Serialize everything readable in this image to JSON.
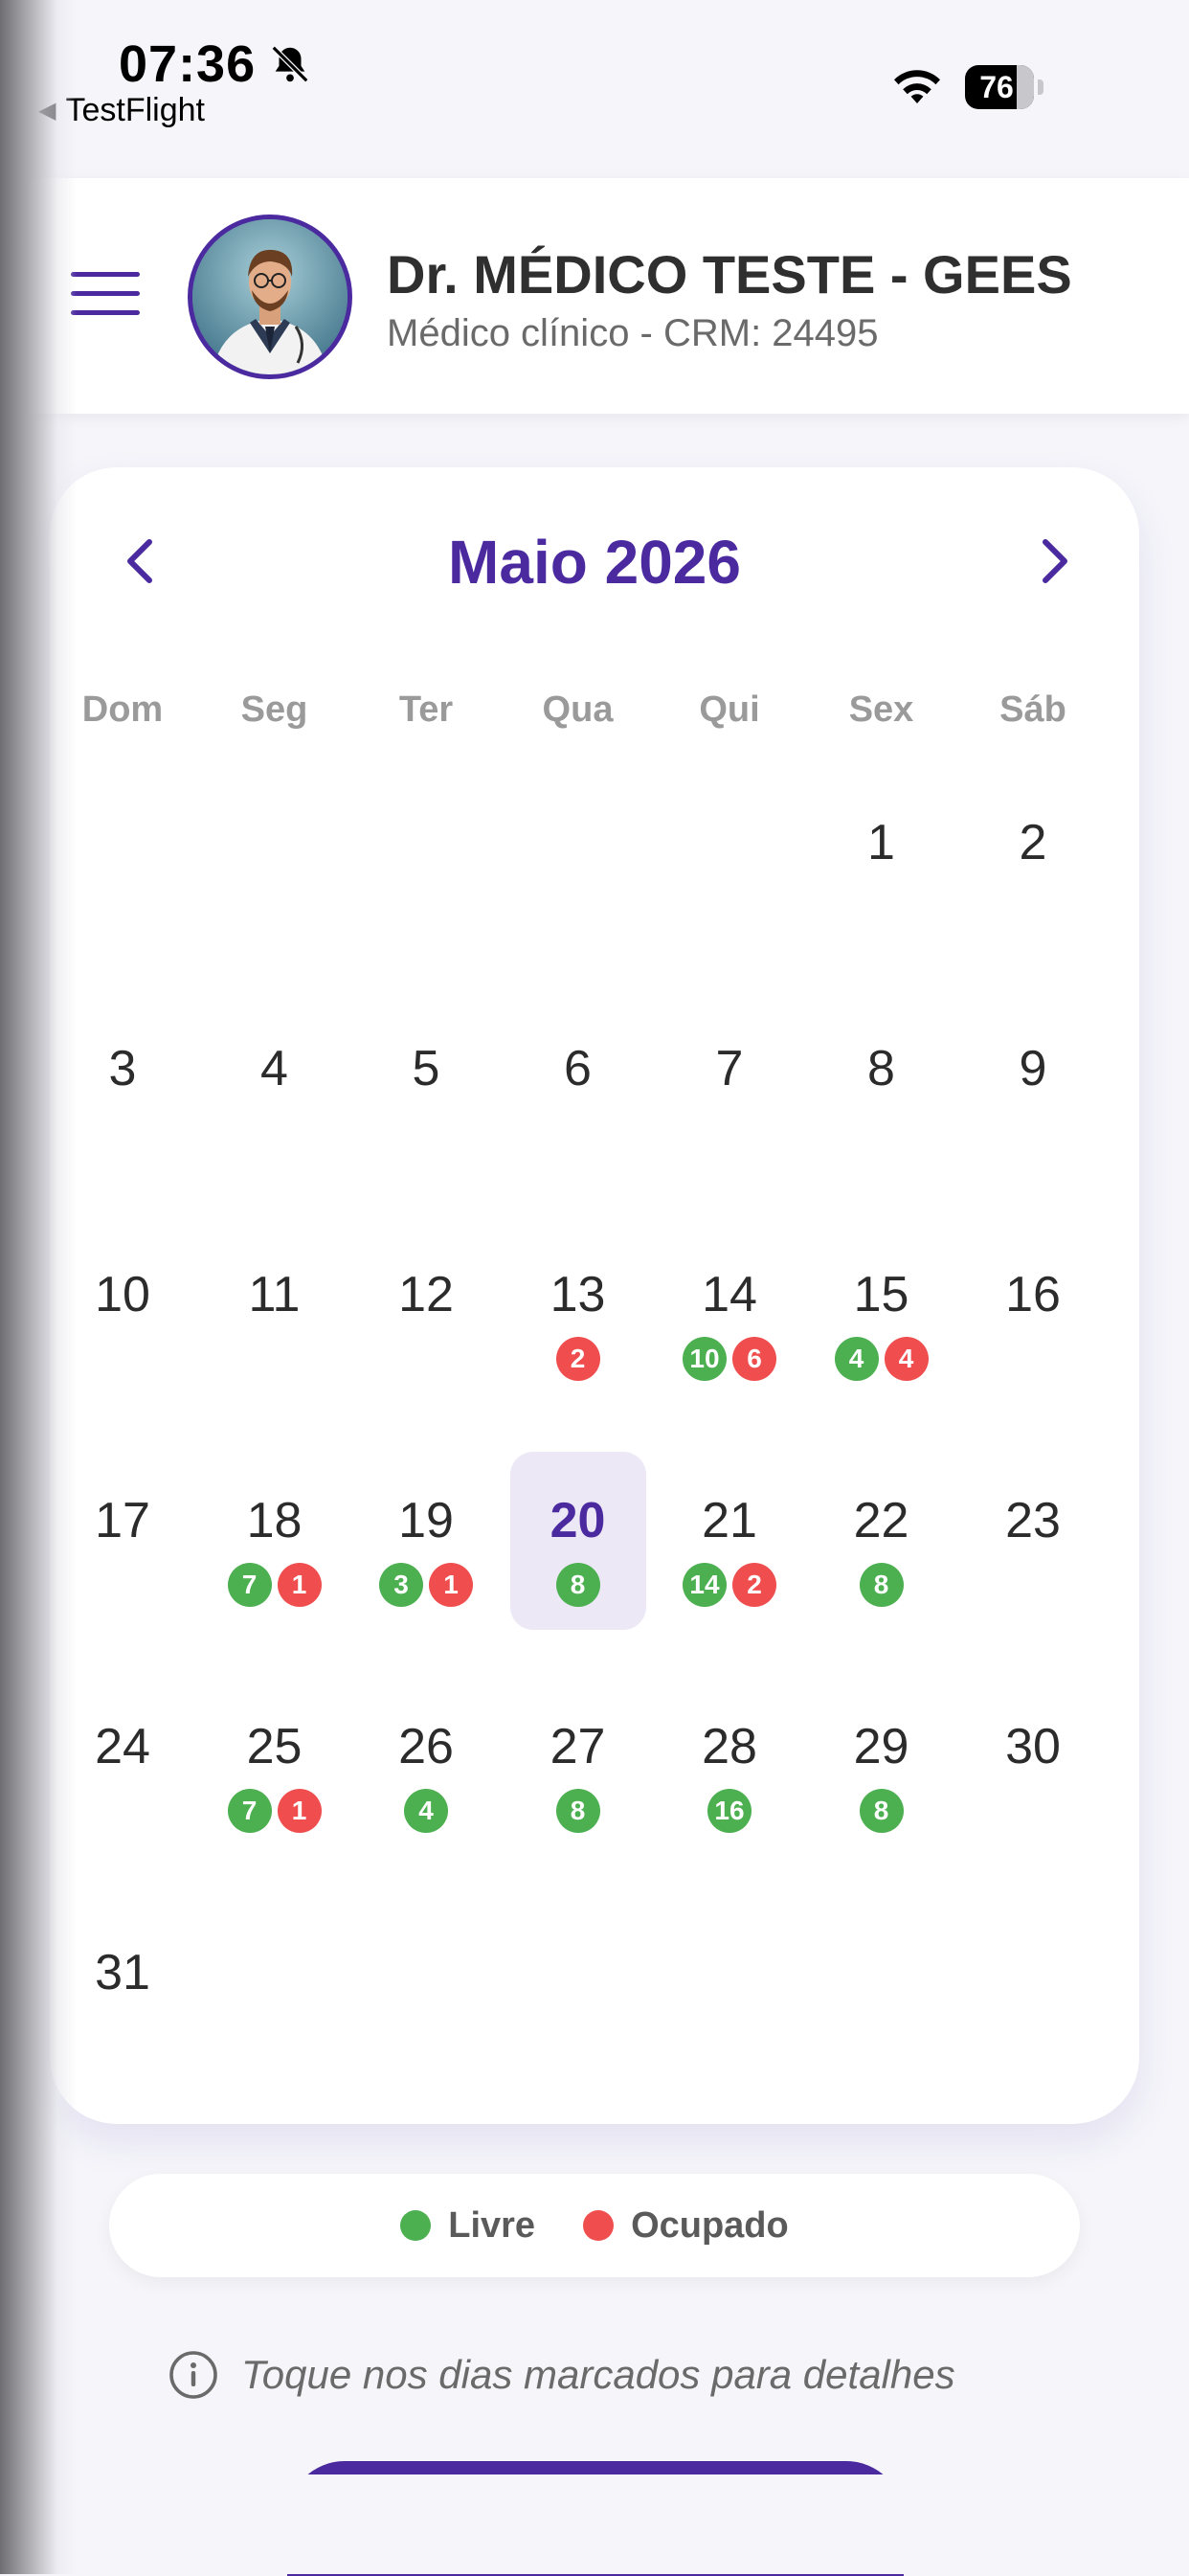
{
  "status_bar": {
    "time": "07:36",
    "back_app": "TestFlight",
    "battery": "76"
  },
  "header": {
    "doctor_name": "Dr. MÉDICO TESTE - GEES",
    "subtitle": "Médico clínico - CRM: 24495",
    "accent_color": "#4b2aa0"
  },
  "calendar": {
    "month_title": "Maio 2026",
    "weekdays": [
      "Dom",
      "Seg",
      "Ter",
      "Qua",
      "Qui",
      "Sex",
      "Sáb"
    ],
    "start_weekday_index": 5,
    "days_in_month": 31,
    "selected_day": 20,
    "badges": {
      "13": {
        "busy": 2
      },
      "14": {
        "free": 10,
        "busy": 6
      },
      "15": {
        "free": 4,
        "busy": 4
      },
      "18": {
        "free": 7,
        "busy": 1
      },
      "19": {
        "free": 3,
        "busy": 1
      },
      "20": {
        "free": 8
      },
      "21": {
        "free": 14,
        "busy": 2
      },
      "22": {
        "free": 8
      },
      "25": {
        "free": 7,
        "busy": 1
      },
      "26": {
        "free": 4
      },
      "27": {
        "free": 8
      },
      "28": {
        "free": 16
      },
      "29": {
        "free": 8
      }
    },
    "colors": {
      "free": "#4caf50",
      "busy": "#f04e4e"
    }
  },
  "legend": {
    "free_label": "Livre",
    "busy_label": "Ocupado"
  },
  "hint": {
    "text": "Toque nos dias marcados para detalhes"
  }
}
